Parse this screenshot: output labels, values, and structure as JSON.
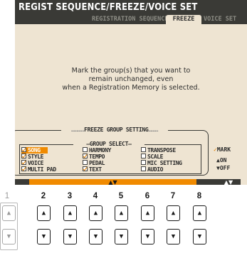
{
  "title": "REGIST SEQUENCE/FREEZE/VOICE SET",
  "tabs": [
    {
      "label": "REGISTRATION SEQUENCE"
    },
    {
      "label": "FREEZE"
    },
    {
      "label": "VOICE SET"
    }
  ],
  "message": {
    "line1": "Mark the group(s) that you want to",
    "line2": "remain unchanged, even",
    "line3": "when a Registration Memory is selected."
  },
  "freeze_panel": {
    "title": "FREEZE GROUP SETTING",
    "group_select_title": "GROUP SELECT",
    "items": [
      {
        "label": "SONG",
        "checked": true
      },
      {
        "label": "STYLE",
        "checked": true
      },
      {
        "label": "VOICE",
        "checked": true
      },
      {
        "label": "MULTI PAD",
        "checked": true
      },
      {
        "label": "HARMONY",
        "checked": false
      },
      {
        "label": "TEMPO",
        "checked": true
      },
      {
        "label": "PEDAL",
        "checked": false
      },
      {
        "label": "TEXT",
        "checked": true
      },
      {
        "label": "TRANSPOSE",
        "checked": false
      },
      {
        "label": "SCALE",
        "checked": false
      },
      {
        "label": "MIC SETTING",
        "checked": false
      },
      {
        "label": "AUDIO",
        "checked": false
      }
    ],
    "legend": {
      "mark": "MARK",
      "on": "ON",
      "off": "OFF"
    }
  },
  "bottom_bar": {
    "cursor_arrows": "▲▼",
    "right_arrows": "▲▼"
  },
  "button_numbers": [
    "1",
    "2",
    "3",
    "4",
    "5",
    "6",
    "7",
    "8"
  ],
  "colors": {
    "accent": "#f08a00",
    "screen_bg": "#eee4d2",
    "titlebar": "#3a3a36"
  }
}
